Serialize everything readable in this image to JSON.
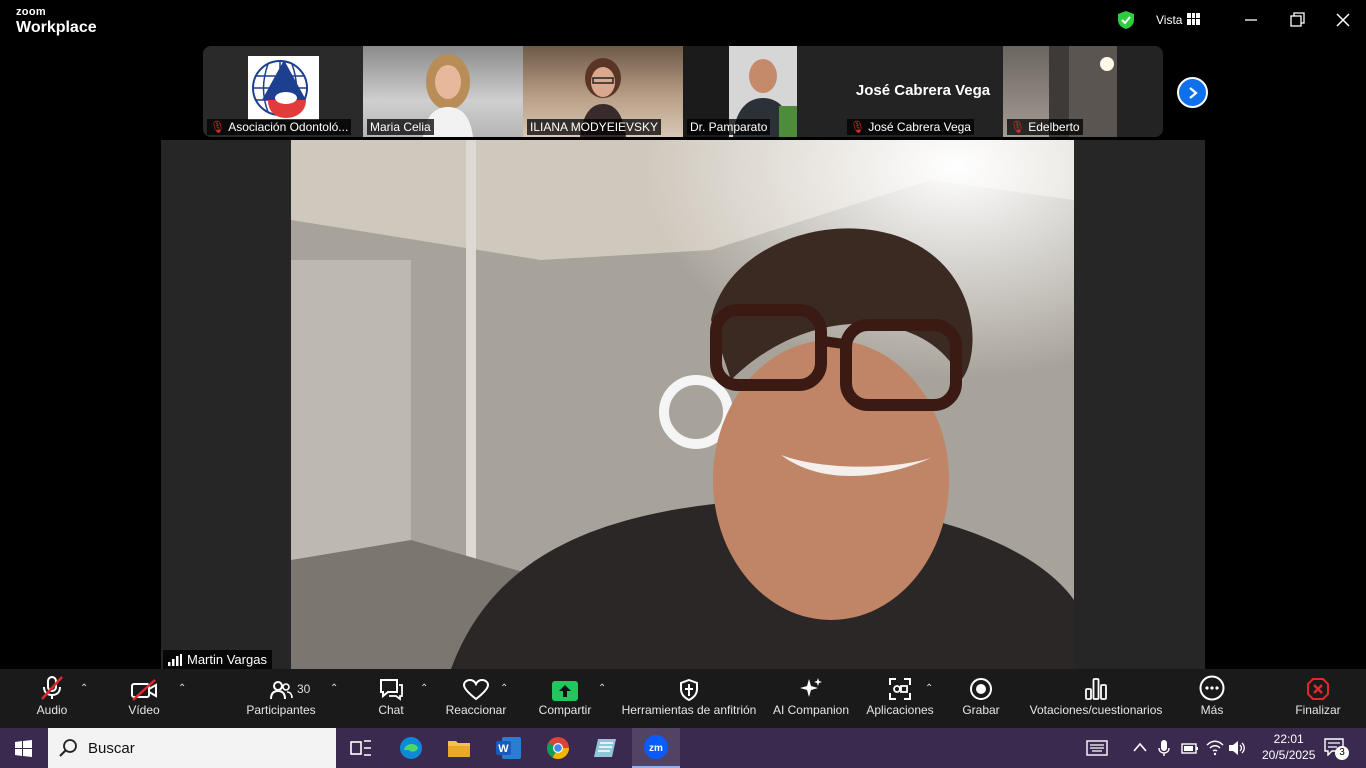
{
  "app": {
    "brand_top": "zoom",
    "brand_bottom": "Workplace",
    "view_label": "Vista"
  },
  "colors": {
    "accent_blue": "#0e71eb",
    "share_green": "#22c55e",
    "end_red": "#e02a2a",
    "shield_green": "#2ecc40"
  },
  "participants_strip": [
    {
      "name": "Asociación Odontoló...",
      "muted": true
    },
    {
      "name": "Maria Celia",
      "muted": false
    },
    {
      "name": "ILIANA MODYEIEVSKY",
      "muted": false
    },
    {
      "name": "Dr. Pamparato",
      "muted": false
    },
    {
      "name": "José Cabrera Vega",
      "muted": true,
      "display_title": "José Cabrera Vega"
    },
    {
      "name": "Edelberto",
      "muted": true
    }
  ],
  "main": {
    "speaker_name": "Martin Vargas"
  },
  "toolbar": {
    "audio": "Audio",
    "video": "Vídeo",
    "participants": "Participantes",
    "participants_count": "30",
    "chat": "Chat",
    "react": "Reaccionar",
    "share": "Compartir",
    "host_tools": "Herramientas de anfitrión",
    "ai": "AI Companion",
    "apps": "Aplicaciones",
    "record": "Grabar",
    "polls": "Votaciones/cuestionarios",
    "more": "Más",
    "end": "Finalizar"
  },
  "taskbar": {
    "search_placeholder": "Buscar",
    "time": "22:01",
    "date": "20/5/2025",
    "notifications": "3"
  }
}
